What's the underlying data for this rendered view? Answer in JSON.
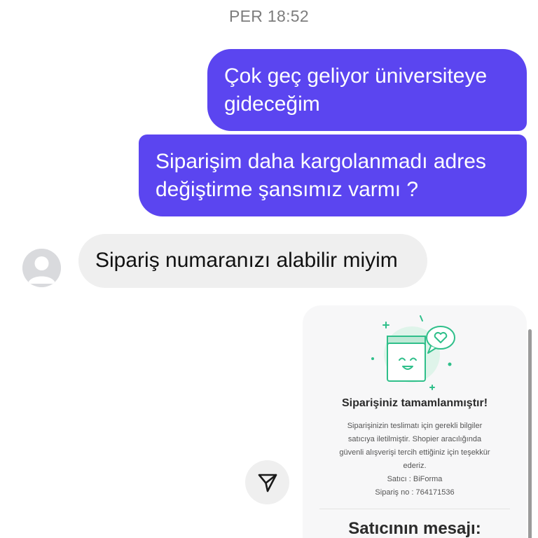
{
  "header": {
    "timestamp": "PER 18:52"
  },
  "messages": {
    "outgoing": [
      {
        "lines": [
          "Çok geç geliyor üniversiteye",
          "gideceğim"
        ]
      },
      {
        "lines": [
          "Siparişim daha kargolanmadı adres",
          "değiştirme şansımız varmı ?"
        ]
      }
    ],
    "incoming": [
      {
        "text": "Sipariş numaranızı alabilir miyim"
      }
    ]
  },
  "order_card": {
    "title": "Siparişiniz tamamlanmıştır!",
    "body_lines": [
      "Siparişinizin teslimatı için gerekli bilgiler",
      "satıcıya iletilmiştir. Shopier aracılığında",
      "güvenli alışverişi tercih ettiğiniz için teşekkür",
      "ederiz."
    ],
    "seller_line": "Satıcı : BiForma",
    "order_line": "Sipariş no : 764171536",
    "seller_message_heading": "Satıcının mesajı:"
  },
  "icons": {
    "avatar": "default-user-avatar-icon",
    "share": "paper-plane-icon",
    "illustration": "happy-box-with-heart-icon"
  },
  "colors": {
    "outgoing_bubble": "#5b45f0",
    "incoming_bubble": "#efefef",
    "card_background": "#f7f7f8",
    "illustration_accent": "#2fbf8a"
  }
}
